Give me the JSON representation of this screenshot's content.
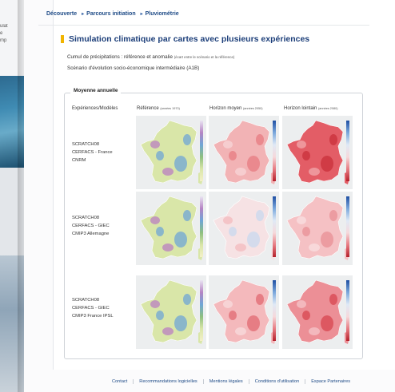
{
  "background_window": {
    "snippets": [
      "ulat",
      "e",
      "mp"
    ]
  },
  "breadcrumb": {
    "items": [
      "Découverte",
      "Parcours initiation",
      "Pluviométrie"
    ]
  },
  "page_title": "Simulation climatique par cartes avec plusieurs expériences",
  "subtitle": {
    "main": "Cumul de précipitations : référence et anomalie",
    "note": "(écart entre le scénario et la référence)",
    "scenario": "Scénario d'évolution socio-économique intermédiaire (A1B)"
  },
  "section": {
    "legend": "Moyenne annuelle",
    "columns": [
      {
        "label": "Expériences/Modèles",
        "note": ""
      },
      {
        "label": "Référence",
        "note": "(années 1970)"
      },
      {
        "label": "Horizon moyen",
        "note": "(années 2050)"
      },
      {
        "label": "Horizon lointain",
        "note": "(années 2080)"
      }
    ],
    "rows": [
      {
        "lines": [
          "SCRATCH08",
          "CERFACS - France",
          "CNRM"
        ],
        "maps": [
          {
            "name": "reference-map",
            "fill": "#d9e6a8",
            "accent": "#6fa6d6",
            "spots": "#b97fc2"
          },
          {
            "name": "horizon-moyen-map",
            "fill": "#f2b3b5",
            "accent": "#e77b82",
            "spots": "#f7d6d8"
          },
          {
            "name": "horizon-lointain-map",
            "fill": "#e35d66",
            "accent": "#c9303b",
            "spots": "#f2a9ad"
          }
        ]
      },
      {
        "lines": [
          "SCRATCH08",
          "CERFACS - GIEC",
          "CMIP3 Allemagne"
        ],
        "maps": [
          {
            "name": "reference-map",
            "fill": "#d9e6a8",
            "accent": "#6fa6d6",
            "spots": "#b97fc2"
          },
          {
            "name": "horizon-moyen-map",
            "fill": "#f6e2e4",
            "accent": "#c8d8ef",
            "spots": "#f3b9bd"
          },
          {
            "name": "horizon-lointain-map",
            "fill": "#f5c1c4",
            "accent": "#e88f96",
            "spots": "#f8dfe1"
          }
        ]
      },
      {
        "lines": [
          "SCRATCH08",
          "CERFACS - GIEC",
          "CMIP3 France IPSL"
        ],
        "maps": [
          {
            "name": "reference-map",
            "fill": "#d9e6a8",
            "accent": "#6fa6d6",
            "spots": "#b97fc2"
          },
          {
            "name": "horizon-moyen-map",
            "fill": "#f4b9bc",
            "accent": "#e26a72",
            "spots": "#f8dcde"
          },
          {
            "name": "horizon-lointain-map",
            "fill": "#ec8f96",
            "accent": "#d8454f",
            "spots": "#f6c6c9"
          }
        ]
      }
    ],
    "scale_colors": {
      "reference": [
        "#e9e4f1",
        "#b584c4",
        "#6fa6d6",
        "#8fc07f",
        "#d9e6a8",
        "#f3f0c8"
      ],
      "anomaly": [
        "#1f4fa3",
        "#7aa7dc",
        "#dfe9f6",
        "#f6d9db",
        "#e77b82",
        "#b5212c"
      ]
    }
  },
  "footer": {
    "links": [
      "Contact",
      "Recommandations logicielles",
      "Mentions légales",
      "Conditions d'utilisation",
      "Espace Partenaires"
    ]
  }
}
